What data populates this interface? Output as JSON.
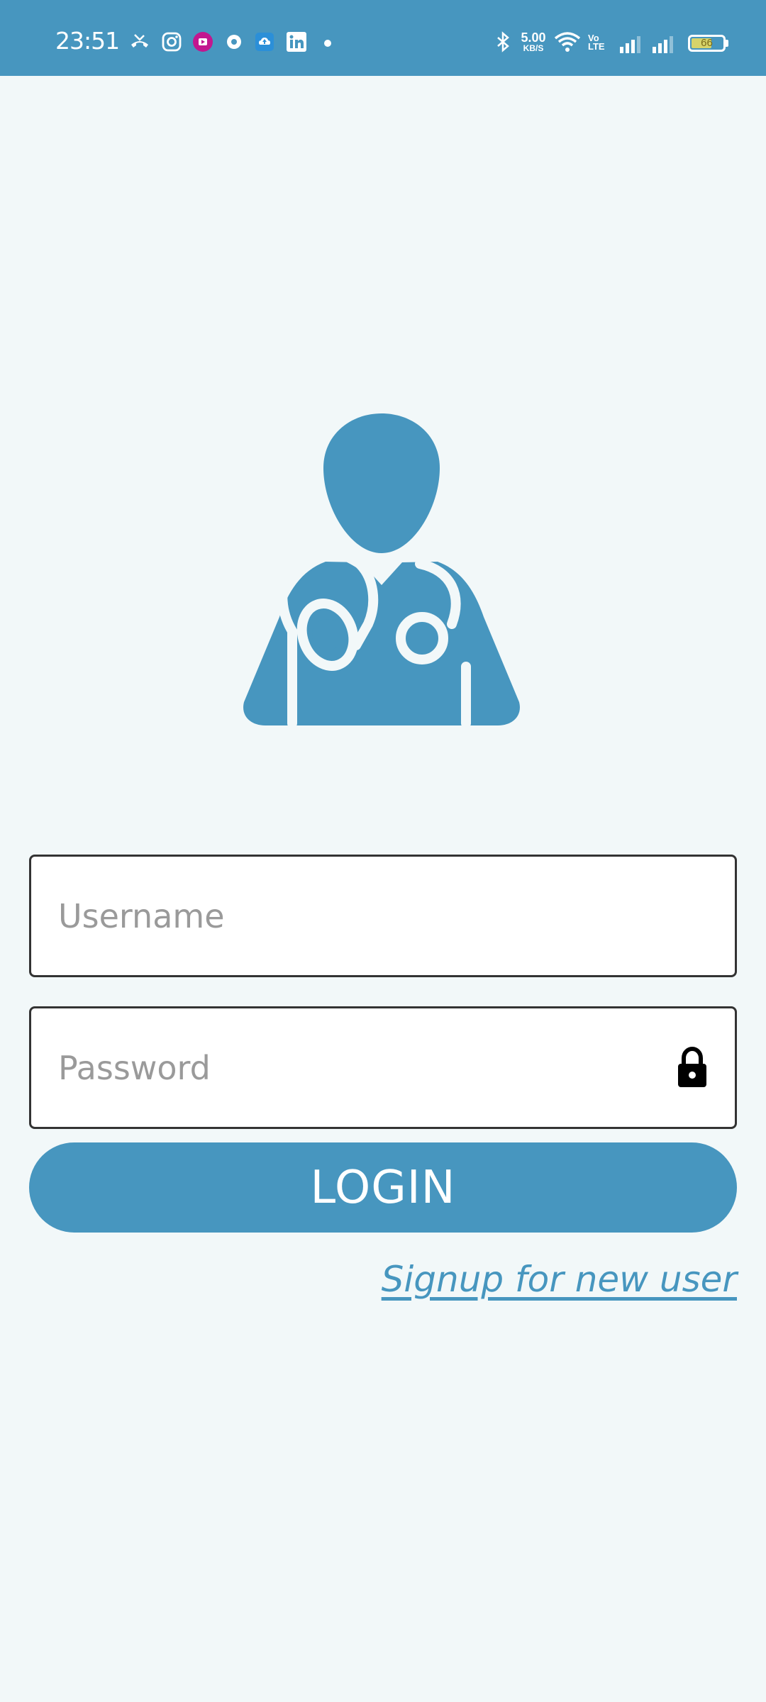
{
  "status_bar": {
    "time": "23:51",
    "network_speed": "5.00",
    "network_speed_unit": "KB/S",
    "volte_top": "Vo",
    "volte_bottom": "LTE",
    "battery_level": "66",
    "battery_fraction": 0.66,
    "notification_icons": [
      "missed-call-icon",
      "instagram-icon",
      "video-app-icon",
      "chrome-icon",
      "cloud-app-icon",
      "linkedin-icon",
      "more-dot-icon"
    ],
    "system_icons": [
      "bluetooth-icon",
      "wifi-icon",
      "signal-1-icon",
      "signal-2-icon",
      "battery-icon"
    ]
  },
  "login_form": {
    "username_placeholder": "Username",
    "password_placeholder": "Password",
    "login_label": "LOGIN",
    "signup_link": "Signup for new user"
  },
  "colors": {
    "primary": "#4796bf",
    "background": "#f2f8f9",
    "border": "#333333"
  }
}
